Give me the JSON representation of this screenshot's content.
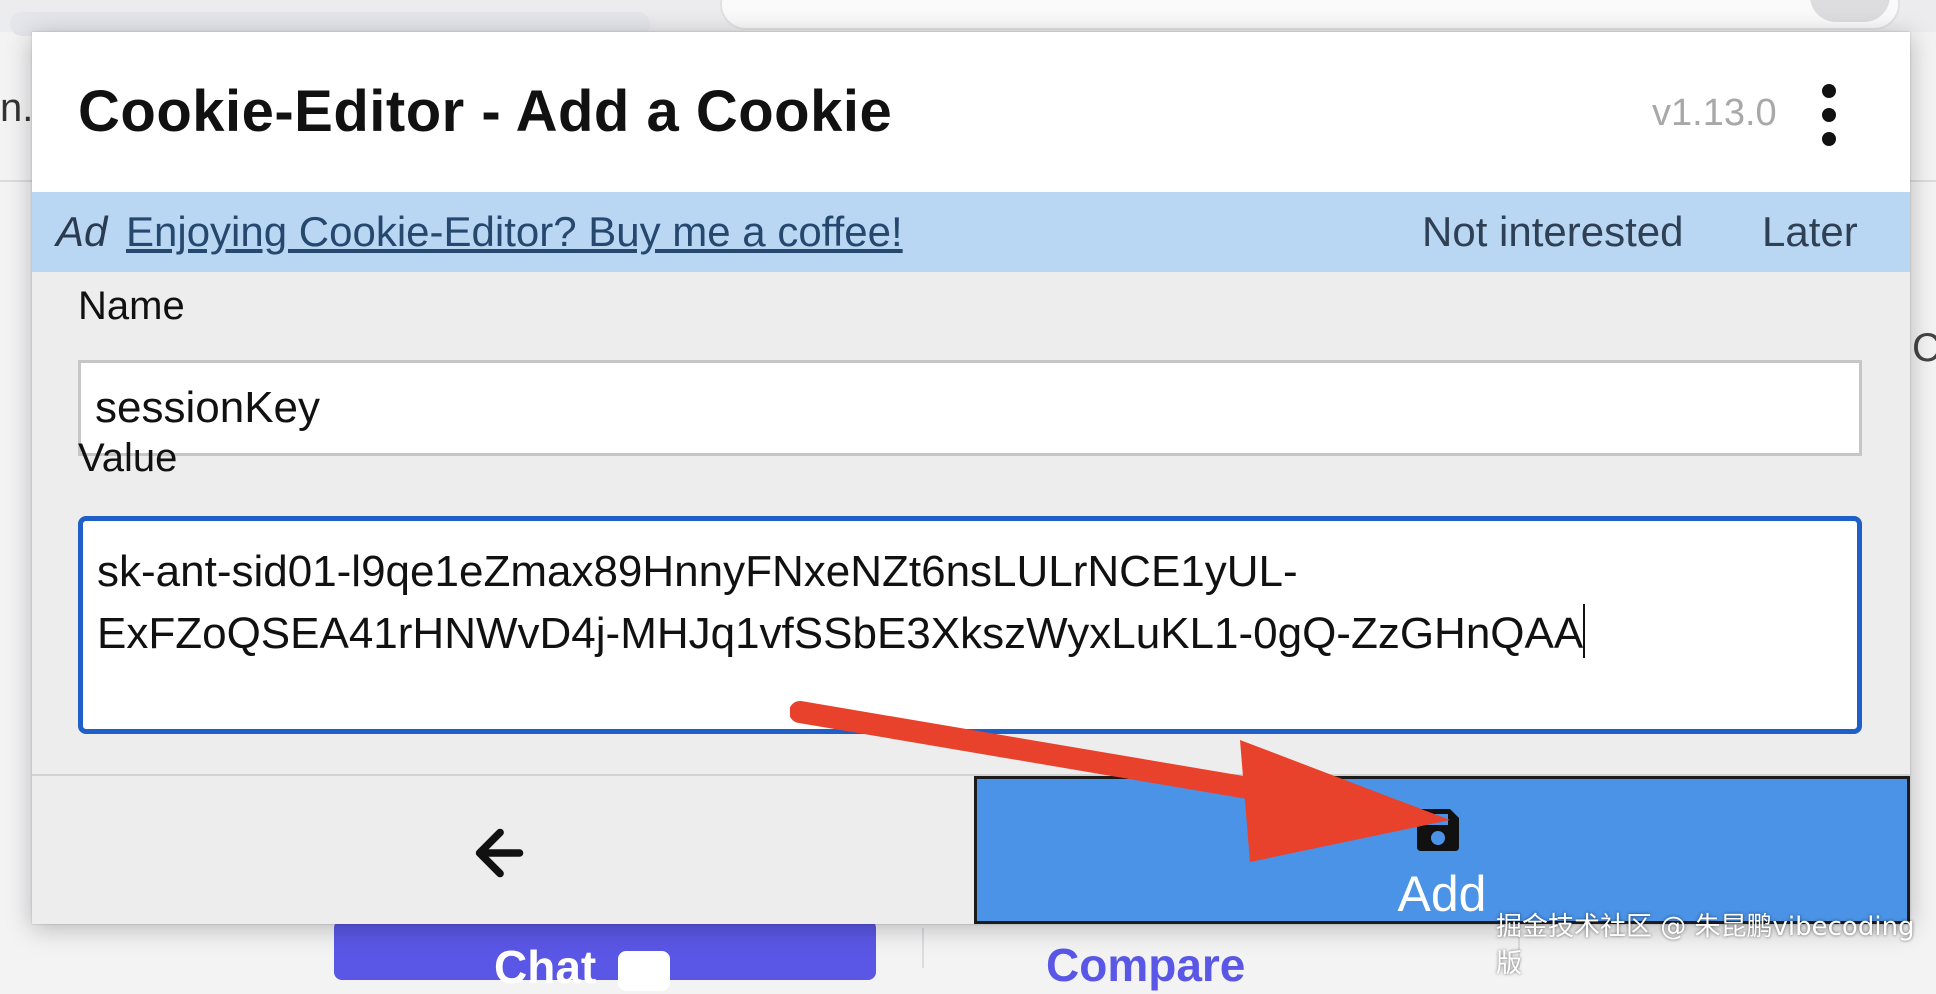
{
  "background": {
    "left_text_fragment": "n.",
    "right_text_fragment": "C",
    "chat_button_label": "Chat",
    "compare_link_label": "Compare"
  },
  "popup": {
    "title": "Cookie-Editor - Add a Cookie",
    "version": "v1.13.0",
    "menu_icon": "kebab-menu-icon",
    "ad": {
      "tag": "Ad",
      "link_text": "Enjoying Cookie-Editor? Buy me a coffee!",
      "not_interested": "Not interested",
      "later": "Later"
    },
    "form": {
      "name_label": "Name",
      "name_value": "sessionKey",
      "value_label": "Value",
      "value_line1": "sk-ant-sid01-l9qe1eZmax89HnnyFNxeNZt6nsLULrNCE1yUL-",
      "value_line2": "ExFZoQSEA41rHNWvD4j-MHJq1vfSSbE3XkszWyxLuKL1-0gQ-ZzGHnQAA"
    },
    "footer": {
      "back_icon": "arrow-left-icon",
      "add_icon": "save-icon",
      "add_label": "Add"
    }
  },
  "colors": {
    "ad_bar": "#b9d7f3",
    "add_button": "#4b93e7",
    "input_focus_border": "#1f5fc8",
    "annotation_arrow": "#e8412c",
    "chat_button": "#5b57e6"
  },
  "watermark": "掘金技术社区 @ 朱昆鹏vibecoding版"
}
